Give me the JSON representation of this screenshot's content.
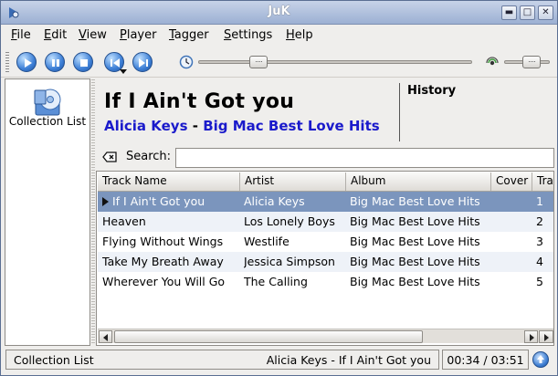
{
  "window": {
    "title": "JuK"
  },
  "menubar": {
    "items": [
      "File",
      "Edit",
      "View",
      "Player",
      "Tagger",
      "Settings",
      "Help"
    ],
    "underline": [
      "F",
      "E",
      "V",
      "P",
      "T",
      "S",
      "H"
    ]
  },
  "toolbar": {
    "position_fraction": 0.2,
    "volume_fraction": 0.65
  },
  "sidebar": {
    "collection_label": "Collection List"
  },
  "now_playing": {
    "title": "If I Ain't Got you",
    "artist": "Alicia Keys",
    "separator": "-",
    "album": "Big Mac Best Love Hits",
    "history_label": "History"
  },
  "search": {
    "label": "Search:",
    "value": ""
  },
  "tracklist": {
    "columns": [
      "Track Name",
      "Artist",
      "Album",
      "Cover",
      "Track"
    ],
    "rows": [
      {
        "track": "If I Ain't Got you",
        "artist": "Alicia Keys",
        "album": "Big Mac Best Love Hits",
        "number": "1",
        "playing": true
      },
      {
        "track": "Heaven",
        "artist": "Los Lonely Boys",
        "album": "Big Mac Best Love Hits",
        "number": "2"
      },
      {
        "track": "Flying Without Wings",
        "artist": "Westlife",
        "album": "Big Mac Best Love Hits",
        "number": "3"
      },
      {
        "track": "Take My Breath Away",
        "artist": "Jessica Simpson",
        "album": "Big Mac Best Love Hits",
        "number": "4"
      },
      {
        "track": "Wherever You Will Go",
        "artist": "The Calling",
        "album": "Big Mac Best Love Hits",
        "number": "5"
      }
    ]
  },
  "statusbar": {
    "playlist": "Collection List",
    "now_playing": "Alicia Keys - If I Ain't Got you",
    "time": "00:34 / 03:51"
  },
  "colors": {
    "selection": "#7b95bd",
    "link": "#1a1acb",
    "titlebar": "#9cb0d3"
  }
}
